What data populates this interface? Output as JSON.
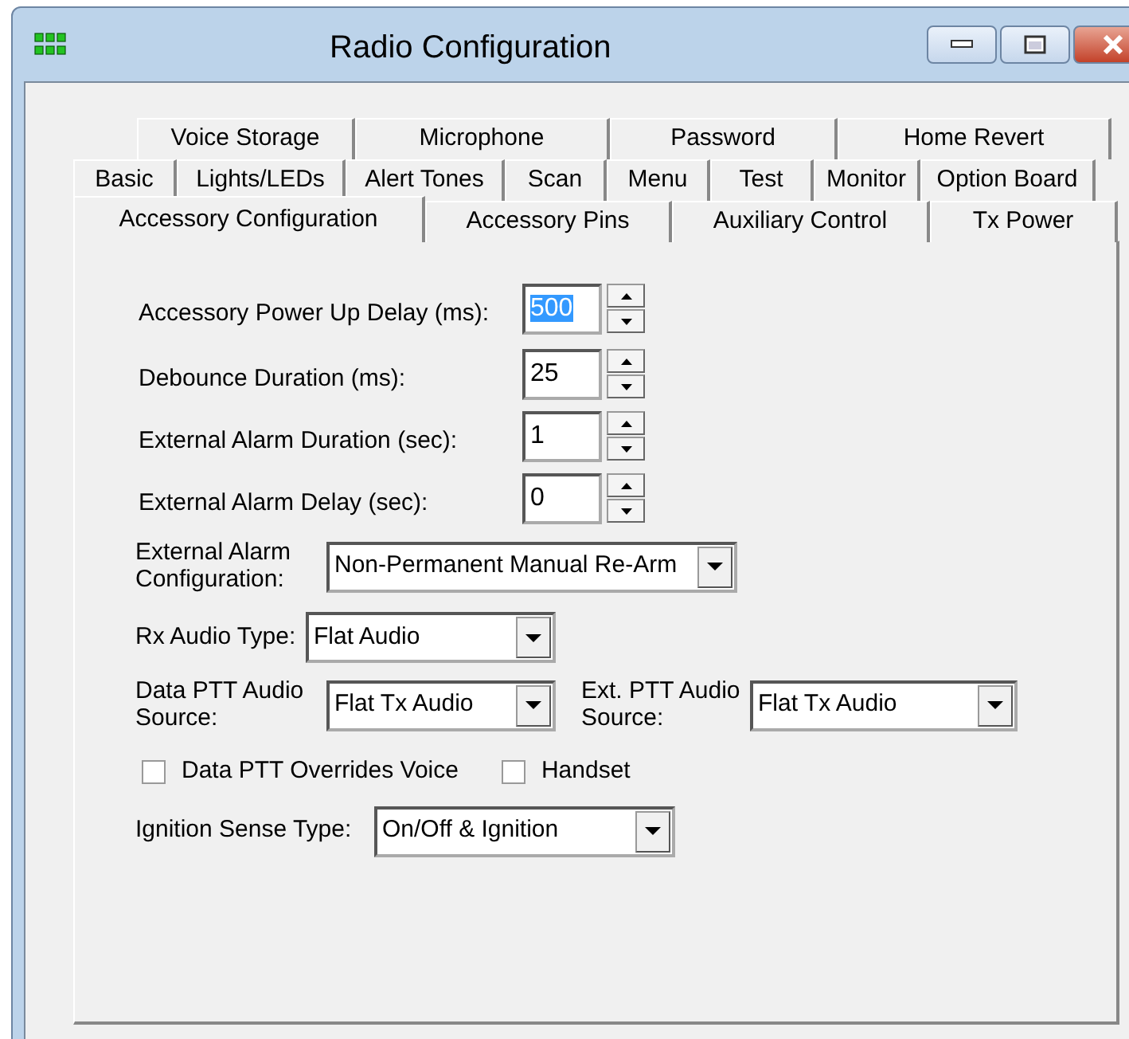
{
  "window": {
    "title": "Radio Configuration"
  },
  "tab_rows": [
    [
      {
        "label": "Voice Storage",
        "selected": false
      },
      {
        "label": "Microphone",
        "selected": false
      },
      {
        "label": "Password",
        "selected": false
      },
      {
        "label": "Home Revert",
        "selected": false
      }
    ],
    [
      {
        "label": "Basic",
        "selected": false
      },
      {
        "label": "Lights/LEDs",
        "selected": false
      },
      {
        "label": "Alert Tones",
        "selected": false
      },
      {
        "label": "Scan",
        "selected": false
      },
      {
        "label": "Menu",
        "selected": false
      },
      {
        "label": "Test",
        "selected": false
      },
      {
        "label": "Monitor",
        "selected": false
      },
      {
        "label": "Option Board",
        "selected": false
      }
    ],
    [
      {
        "label": "Accessory Configuration",
        "selected": true
      },
      {
        "label": "Accessory Pins",
        "selected": false
      },
      {
        "label": "Auxiliary Control",
        "selected": false
      },
      {
        "label": "Tx Power",
        "selected": false
      }
    ]
  ],
  "spinners": [
    {
      "label": "Accessory Power Up Delay (ms):",
      "value": "500",
      "text_selected": true
    },
    {
      "label": "Debounce Duration (ms):",
      "value": "25",
      "text_selected": false
    },
    {
      "label": "External Alarm Duration (sec):",
      "value": "1",
      "text_selected": false
    },
    {
      "label": "External Alarm Delay (sec):",
      "value": "0",
      "text_selected": false
    }
  ],
  "external_alarm_configuration": {
    "label": "External Alarm Configuration:",
    "value": "Non-Permanent Manual Re-Arm"
  },
  "rx_audio_type": {
    "label": "Rx Audio Type:",
    "value": "Flat Audio"
  },
  "data_ptt_audio_source": {
    "label": "Data PTT Audio Source:",
    "value": "Flat Tx Audio"
  },
  "ext_ptt_audio_source": {
    "label": "Ext. PTT Audio Source:",
    "value": "Flat Tx Audio"
  },
  "checkboxes": [
    {
      "label": "Data PTT Overrides Voice",
      "checked": false
    },
    {
      "label": "Handset",
      "checked": false
    }
  ],
  "ignition_sense_type": {
    "label": "Ignition Sense Type:",
    "value": "On/Off & Ignition"
  }
}
